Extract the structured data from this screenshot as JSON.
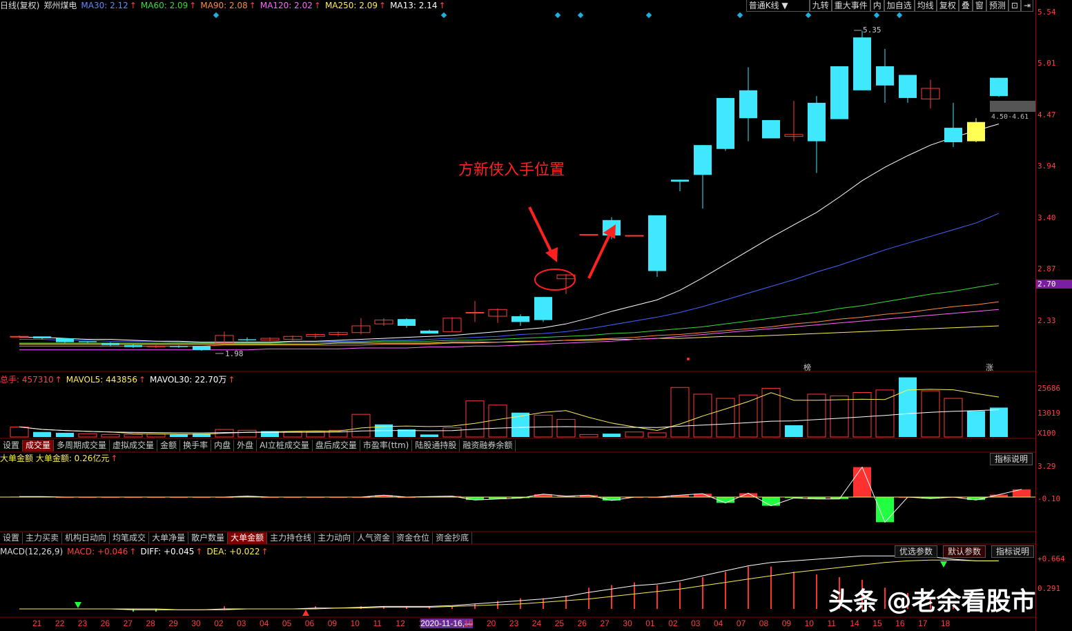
{
  "header": {
    "main": [
      {
        "t": "日线(复权)",
        "c": "#ddd"
      },
      {
        "t": "郑州煤电",
        "c": "#ddd"
      },
      {
        "t": "MA30: 2.12",
        "c": "#5b8cff",
        "up": true
      },
      {
        "t": "MA60: 2.09",
        "c": "#3cdc3c",
        "up": true
      },
      {
        "t": "MA90: 2.08",
        "c": "#ff8a40",
        "up": true
      },
      {
        "t": "MA120: 2.02",
        "c": "#ff66ff",
        "up": true
      },
      {
        "t": "MA250: 2.09",
        "c": "#ffee55",
        "up": true
      },
      {
        "t": "MA13: 2.14",
        "c": "#ffffff",
        "up": true
      }
    ],
    "up_arrow": "↑"
  },
  "toolbar": [
    "普通K线",
    "九转",
    "重大事件",
    "内",
    "加自选",
    "均线",
    "复权",
    "叠",
    "窗",
    "预测",
    "⊡",
    "⇥"
  ],
  "toolbar_dropdown": "▼",
  "price_axis": [
    "5.54",
    "5.01",
    "4.47",
    "3.94",
    "3.40",
    "2.87",
    "2.33"
  ],
  "current_price_tag": "2.70",
  "range_tag": "4.50-4.61",
  "peak_label": "5.35",
  "low_label": "1.98",
  "annotation": "方新侠入手位置",
  "markers": {
    "bang": "榜",
    "zhang": "涨"
  },
  "volume": {
    "header": [
      {
        "t": "总手: 457310",
        "c": "#ff4040",
        "up": true
      },
      {
        "t": "MAVOL5: 443856",
        "c": "#ffee55",
        "up": true
      },
      {
        "t": "MAVOL30: 22.70万",
        "c": "#ffffff",
        "up": true
      }
    ],
    "axis": [
      "25686",
      "13019",
      "X100"
    ]
  },
  "tabs1": [
    "设置",
    "成交量",
    "多周期成交量",
    "虚拟成交量",
    "金额",
    "换手率",
    "内盘",
    "外盘",
    "AI立桩成交量",
    "盘后成交量",
    "市盈率(ttm)",
    "陆股通持股",
    "融资融券余额"
  ],
  "tabs1_active": 1,
  "bigorder": {
    "header": [
      {
        "t": "大单金额 大单金额: 0.26亿元",
        "c": "#ffee55",
        "up": true
      }
    ],
    "axis": [
      "3.29",
      "-0.10"
    ],
    "explain": "指标说明"
  },
  "tabs2": [
    "设置",
    "主力买卖",
    "机构日动向",
    "均笔成交",
    "大单净量",
    "散户数量",
    "大单金额",
    "主力持仓线",
    "主力动向",
    "人气资金",
    "资金仓位",
    "资金抄底"
  ],
  "tabs2_active": 6,
  "macd": {
    "header": [
      {
        "t": "MACD(12,26,9)",
        "c": "#ddd"
      },
      {
        "t": "MACD: +0.046",
        "c": "#ff4040",
        "up": true
      },
      {
        "t": "DIFF: +0.045",
        "c": "#ffffff",
        "up": true
      },
      {
        "t": "DEA: +0.022",
        "c": "#ffee55",
        "up": true
      }
    ],
    "axis": [
      "+0.664",
      "0.291"
    ],
    "buttons": [
      "优选参数",
      "默认参数",
      "指标说明"
    ]
  },
  "dates": [
    "21",
    "22",
    "23",
    "26",
    "27",
    "28",
    "29",
    "30",
    "02",
    "03",
    "04",
    "05",
    "06",
    "09",
    "10",
    "11",
    "12",
    "13",
    "2020-11-16,—",
    "19",
    "20",
    "23",
    "24",
    "25",
    "26",
    "27",
    "30",
    "01",
    "02",
    "03",
    "04",
    "07",
    "08",
    "09",
    "10",
    "11",
    "14",
    "15",
    "16",
    "17",
    "18"
  ],
  "watermark": "头条 @老余看股市",
  "chart_data": {
    "type": "candlestick",
    "title": "郑州煤电 日线(复权)",
    "candles": [
      [
        2.17,
        2.18,
        2.16,
        2.17
      ],
      [
        2.17,
        2.17,
        2.14,
        2.15
      ],
      [
        2.15,
        2.15,
        2.1,
        2.11
      ],
      [
        2.12,
        2.12,
        2.1,
        2.11
      ],
      [
        2.1,
        2.11,
        2.07,
        2.08
      ],
      [
        2.08,
        2.09,
        2.05,
        2.06
      ],
      [
        2.07,
        2.08,
        2.05,
        2.07
      ],
      [
        2.07,
        2.08,
        2.05,
        2.06
      ],
      [
        2.07,
        2.07,
        2.02,
        2.03
      ],
      [
        2.1,
        2.22,
        2.09,
        2.18
      ],
      [
        2.14,
        2.16,
        2.12,
        2.13
      ],
      [
        2.13,
        2.16,
        2.12,
        2.15
      ],
      [
        2.14,
        2.18,
        2.13,
        2.17
      ],
      [
        2.17,
        2.2,
        2.15,
        2.19
      ],
      [
        2.19,
        2.22,
        2.17,
        2.21
      ],
      [
        2.21,
        2.36,
        2.19,
        2.28
      ],
      [
        2.3,
        2.36,
        2.28,
        2.34
      ],
      [
        2.35,
        2.36,
        2.26,
        2.28
      ],
      [
        2.23,
        2.24,
        2.2,
        2.2
      ],
      [
        2.22,
        2.37,
        2.22,
        2.36
      ],
      [
        2.42,
        2.54,
        2.32,
        2.42
      ],
      [
        2.38,
        2.46,
        2.31,
        2.45
      ],
      [
        2.38,
        2.4,
        2.28,
        2.32
      ],
      [
        2.58,
        2.58,
        2.32,
        2.34
      ],
      [
        2.77,
        2.82,
        2.61,
        2.81
      ],
      [
        3.23,
        3.23,
        3.23,
        3.23
      ],
      [
        3.38,
        3.41,
        3.18,
        3.22
      ],
      [
        3.22,
        3.22,
        3.22,
        3.22
      ],
      [
        3.43,
        3.43,
        2.79,
        2.85
      ],
      [
        3.8,
        3.8,
        3.68,
        3.78
      ],
      [
        4.16,
        4.16,
        3.5,
        3.85
      ],
      [
        4.65,
        4.65,
        4.1,
        4.12
      ],
      [
        4.73,
        4.97,
        4.2,
        4.44
      ],
      [
        4.42,
        4.42,
        4.23,
        4.23
      ],
      [
        4.25,
        4.62,
        4.2,
        4.27
      ],
      [
        4.6,
        4.67,
        3.87,
        4.2
      ],
      [
        4.98,
        4.98,
        4.43,
        4.43
      ],
      [
        5.28,
        5.35,
        4.73,
        4.73
      ],
      [
        4.98,
        5.16,
        4.6,
        4.78
      ],
      [
        4.89,
        4.89,
        4.6,
        4.65
      ],
      [
        4.64,
        4.84,
        4.54,
        4.75
      ],
      [
        4.34,
        4.6,
        4.14,
        4.19
      ],
      [
        4.2,
        4.44,
        4.19,
        4.4
      ],
      [
        4.86,
        4.86,
        4.66,
        4.67
      ]
    ],
    "ylim": [
      1.9,
      5.6
    ],
    "ma_lines": {
      "MA13": [
        2.16,
        2.16,
        2.15,
        2.14,
        2.14,
        2.13,
        2.12,
        2.12,
        2.11,
        2.11,
        2.11,
        2.11,
        2.12,
        2.12,
        2.13,
        2.14,
        2.15,
        2.16,
        2.17,
        2.18,
        2.2,
        2.22,
        2.24,
        2.26,
        2.3,
        2.36,
        2.43,
        2.49,
        2.55,
        2.65,
        2.78,
        2.92,
        3.06,
        3.2,
        3.33,
        3.46,
        3.62,
        3.79,
        3.93,
        4.05,
        4.16,
        4.24,
        4.31,
        4.38
      ],
      "MA30": [
        2.14,
        2.14,
        2.13,
        2.13,
        2.12,
        2.12,
        2.12,
        2.11,
        2.11,
        2.11,
        2.11,
        2.11,
        2.11,
        2.11,
        2.12,
        2.12,
        2.13,
        2.13,
        2.14,
        2.15,
        2.16,
        2.17,
        2.19,
        2.2,
        2.22,
        2.25,
        2.29,
        2.33,
        2.37,
        2.42,
        2.48,
        2.55,
        2.62,
        2.69,
        2.76,
        2.84,
        2.91,
        2.99,
        3.07,
        3.14,
        3.21,
        3.28,
        3.35,
        3.45
      ],
      "MA60": [
        2.1,
        2.1,
        2.1,
        2.1,
        2.1,
        2.1,
        2.1,
        2.1,
        2.1,
        2.1,
        2.1,
        2.1,
        2.11,
        2.11,
        2.11,
        2.11,
        2.12,
        2.12,
        2.12,
        2.13,
        2.13,
        2.14,
        2.15,
        2.16,
        2.17,
        2.18,
        2.2,
        2.21,
        2.23,
        2.25,
        2.27,
        2.3,
        2.33,
        2.36,
        2.39,
        2.42,
        2.46,
        2.49,
        2.53,
        2.57,
        2.61,
        2.64,
        2.68,
        2.72
      ],
      "MA90": [
        2.07,
        2.07,
        2.07,
        2.07,
        2.07,
        2.07,
        2.07,
        2.07,
        2.07,
        2.08,
        2.08,
        2.08,
        2.08,
        2.08,
        2.08,
        2.08,
        2.09,
        2.09,
        2.09,
        2.1,
        2.1,
        2.11,
        2.11,
        2.12,
        2.13,
        2.14,
        2.15,
        2.16,
        2.18,
        2.19,
        2.21,
        2.23,
        2.25,
        2.27,
        2.3,
        2.32,
        2.35,
        2.37,
        2.4,
        2.42,
        2.45,
        2.48,
        2.5,
        2.53
      ],
      "MA120": [
        2.03,
        2.03,
        2.03,
        2.03,
        2.03,
        2.03,
        2.03,
        2.03,
        2.03,
        2.03,
        2.03,
        2.04,
        2.04,
        2.04,
        2.04,
        2.05,
        2.05,
        2.05,
        2.06,
        2.06,
        2.07,
        2.07,
        2.08,
        2.09,
        2.1,
        2.11,
        2.12,
        2.14,
        2.15,
        2.17,
        2.19,
        2.21,
        2.23,
        2.25,
        2.27,
        2.29,
        2.31,
        2.33,
        2.35,
        2.37,
        2.39,
        2.41,
        2.43,
        2.45
      ],
      "MA250": [
        2.09,
        2.09,
        2.09,
        2.09,
        2.09,
        2.09,
        2.09,
        2.09,
        2.09,
        2.09,
        2.09,
        2.09,
        2.09,
        2.09,
        2.1,
        2.1,
        2.1,
        2.1,
        2.1,
        2.11,
        2.11,
        2.11,
        2.12,
        2.12,
        2.13,
        2.13,
        2.14,
        2.14,
        2.15,
        2.15,
        2.16,
        2.17,
        2.17,
        2.18,
        2.19,
        2.2,
        2.21,
        2.22,
        2.23,
        2.24,
        2.25,
        2.26,
        2.27,
        2.28
      ]
    },
    "volume": [
      1200,
      600,
      500,
      400,
      300,
      300,
      350,
      300,
      400,
      900,
      800,
      700,
      600,
      600,
      800,
      2700,
      1500,
      900,
      300,
      1100,
      4300,
      3800,
      2900,
      2600,
      2100,
      300,
      400,
      600,
      500,
      5900,
      5100,
      4600,
      5000,
      5800,
      1400,
      5100,
      4900,
      5300,
      5600,
      7100,
      5500,
      4600,
      3100,
      3500,
      3400,
      5200
    ],
    "vol_colors": [
      "r",
      "c",
      "c",
      "r",
      "r",
      "r",
      "r",
      "c",
      "c",
      "r",
      "r",
      "c",
      "r",
      "r",
      "r",
      "r",
      "c",
      "c",
      "c",
      "r",
      "r",
      "r",
      "c",
      "r",
      "r",
      "r",
      "c",
      "r",
      "r",
      "r",
      "r",
      "r",
      "r",
      "r",
      "c",
      "r",
      "r",
      "r",
      "r",
      "c",
      "r",
      "r",
      "c",
      "c",
      "r",
      "r"
    ],
    "bigorder": [
      0.05,
      0.05,
      0.0,
      0.0,
      0.0,
      0.0,
      0.0,
      0.0,
      0.0,
      0.0,
      0.1,
      0.0,
      0.0,
      0.0,
      0.0,
      0.0,
      0.2,
      0.0,
      0.05,
      0.1,
      -0.3,
      -0.2,
      -0.1,
      0.3,
      0.1,
      0.2,
      -0.35,
      0.0,
      0.0,
      0.2,
      0.35,
      -0.6,
      0.4,
      -0.9,
      -0.1,
      -0.2,
      -0.2,
      3.1,
      -2.6,
      0.0,
      -0.15,
      0.0,
      -0.3,
      0.25,
      0.8
    ],
    "macd": {
      "diff": [
        0.0,
        0.0,
        0.0,
        0.0,
        0.0,
        -0.01,
        -0.01,
        -0.01,
        -0.01,
        0.0,
        0.0,
        0.0,
        0.0,
        0.01,
        0.01,
        0.02,
        0.03,
        0.03,
        0.03,
        0.04,
        0.06,
        0.08,
        0.1,
        0.12,
        0.15,
        0.2,
        0.24,
        0.28,
        0.3,
        0.34,
        0.4,
        0.46,
        0.52,
        0.56,
        0.58,
        0.6,
        0.62,
        0.64,
        0.64,
        0.64,
        0.63,
        0.6,
        0.58,
        0.58
      ],
      "dea": [
        0.0,
        0.0,
        0.0,
        0.0,
        0.0,
        0.0,
        0.0,
        -0.01,
        -0.01,
        -0.01,
        0.0,
        0.0,
        0.0,
        0.0,
        0.01,
        0.01,
        0.02,
        0.02,
        0.02,
        0.03,
        0.04,
        0.05,
        0.06,
        0.08,
        0.1,
        0.12,
        0.15,
        0.18,
        0.21,
        0.24,
        0.28,
        0.32,
        0.36,
        0.4,
        0.44,
        0.47,
        0.5,
        0.53,
        0.56,
        0.58,
        0.59,
        0.59,
        0.58,
        0.58
      ]
    }
  }
}
